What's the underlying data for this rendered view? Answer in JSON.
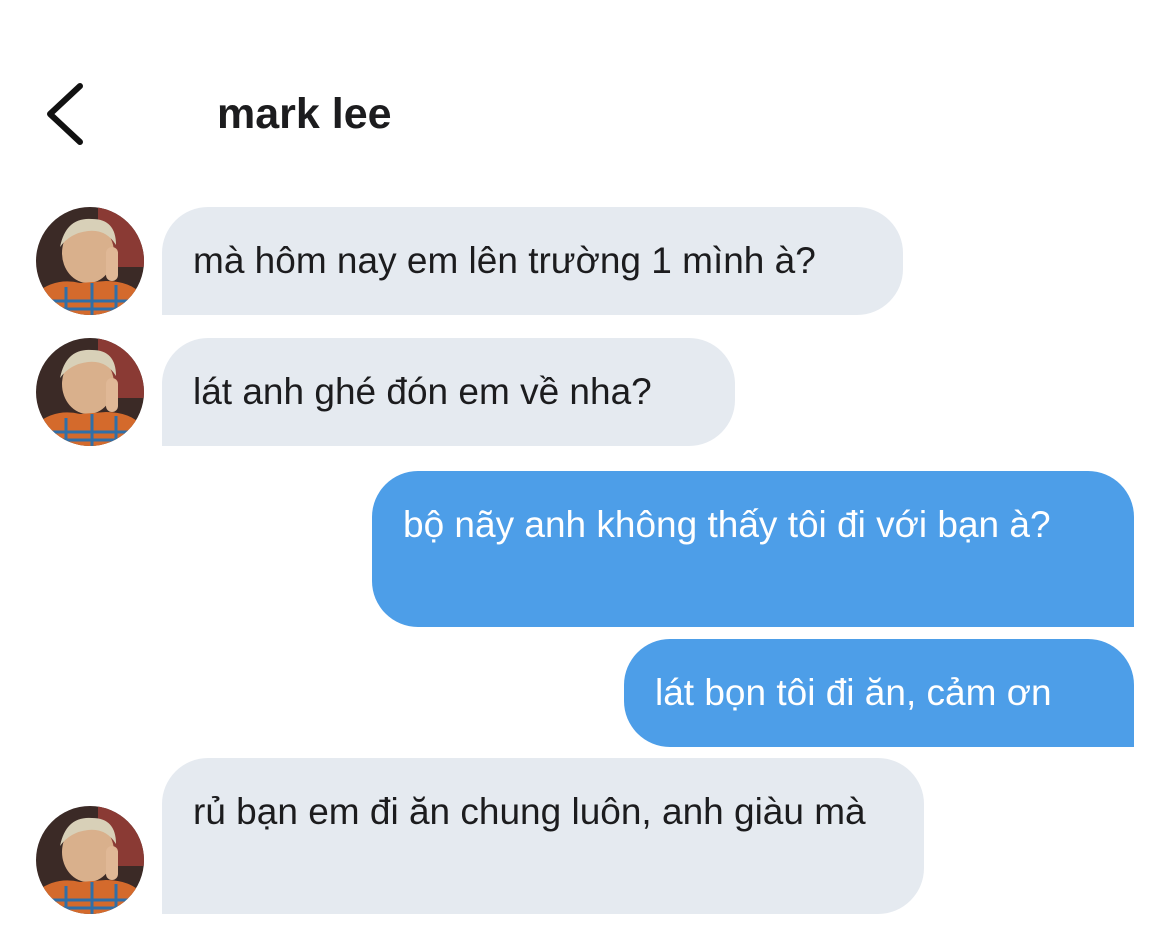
{
  "header": {
    "back_icon": "chevron-left-icon",
    "contact_name": "mark lee"
  },
  "messages": [
    {
      "sender": "contact",
      "text": "mà hôm nay em lên trường 1 mình à?"
    },
    {
      "sender": "contact",
      "text": "lát anh ghé đón em về nha?"
    },
    {
      "sender": "me",
      "text": "bộ nãy anh không thấy tôi đi với bạn à?"
    },
    {
      "sender": "me",
      "text": "lát bọn tôi đi ăn, cảm ơn"
    },
    {
      "sender": "contact",
      "text": "rủ bạn em đi ăn chung luôn, anh giàu mà"
    }
  ],
  "colors": {
    "incoming_bubble": "#e5eaf0",
    "outgoing_bubble": "#4d9ee8",
    "outgoing_text": "#ffffff",
    "text": "#1c1c1e"
  }
}
